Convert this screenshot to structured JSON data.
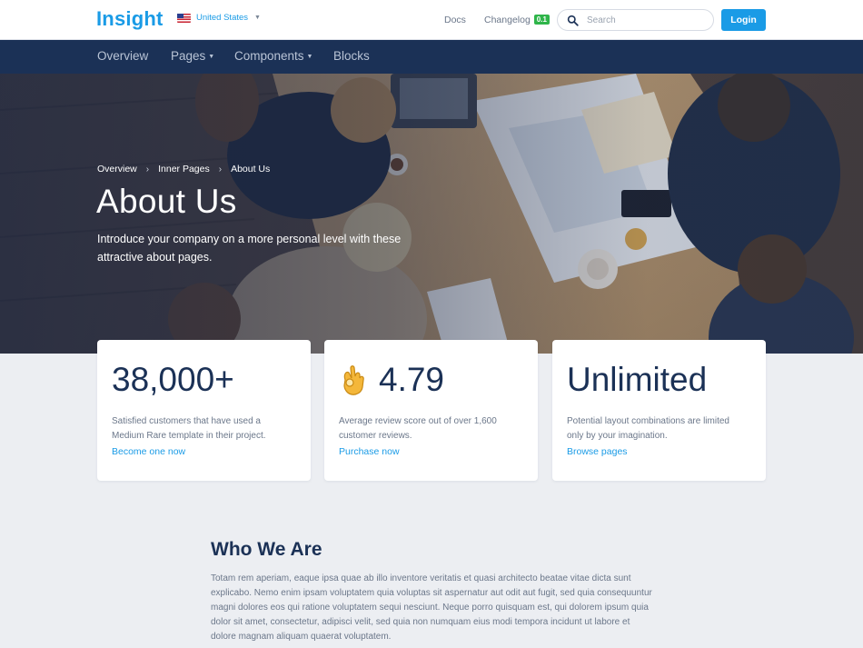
{
  "header": {
    "brand": "Insight",
    "country": "United States",
    "docs": "Docs",
    "changelog": "Changelog",
    "changelog_badge": "0.1",
    "search_placeholder": "Search",
    "login": "Login"
  },
  "nav": {
    "items": [
      "Overview",
      "Pages",
      "Components",
      "Blocks"
    ]
  },
  "hero": {
    "breadcrumb": [
      "Overview",
      "Inner Pages",
      "About Us"
    ],
    "title": "About Us",
    "subtitle": "Introduce your company on a more personal level with these attractive about pages."
  },
  "stats": [
    {
      "value": "38,000+",
      "desc": "Satisfied customers that have used a Medium Rare template in their project.",
      "link": "Become one now"
    },
    {
      "emoji": "👌",
      "value": "4.79",
      "desc": "Average review score out of over 1,600 customer reviews.",
      "link": "Purchase now"
    },
    {
      "value": "Unlimited",
      "desc": "Potential layout combinations are limited only by your imagination.",
      "link": "Browse pages"
    }
  ],
  "who": {
    "title": "Who We Are",
    "text": "Totam rem aperiam, eaque ipsa quae ab illo inventore veritatis et quasi architecto beatae vitae dicta sunt explicabo. Nemo enim ipsam voluptatem quia voluptas sit aspernatur aut odit aut fugit, sed quia consequuntur magni dolores eos qui ratione voluptatem sequi nesciunt. Neque porro quisquam est, qui dolorem ipsum quia dolor sit amet, consectetur, adipisci velit, sed quia non numquam eius modi tempora incidunt ut labore et dolore magnam aliquam quaerat voluptatem."
  },
  "colors": {
    "accent": "#1a9be6",
    "navy": "#1b3156",
    "badge_green": "#2fb54a",
    "page_bg": "#eceef2"
  },
  "icons": [
    "us-flag-icon",
    "caret-down-icon",
    "search-icon",
    "chevron-right-icon",
    "ok-hand-emoji"
  ]
}
